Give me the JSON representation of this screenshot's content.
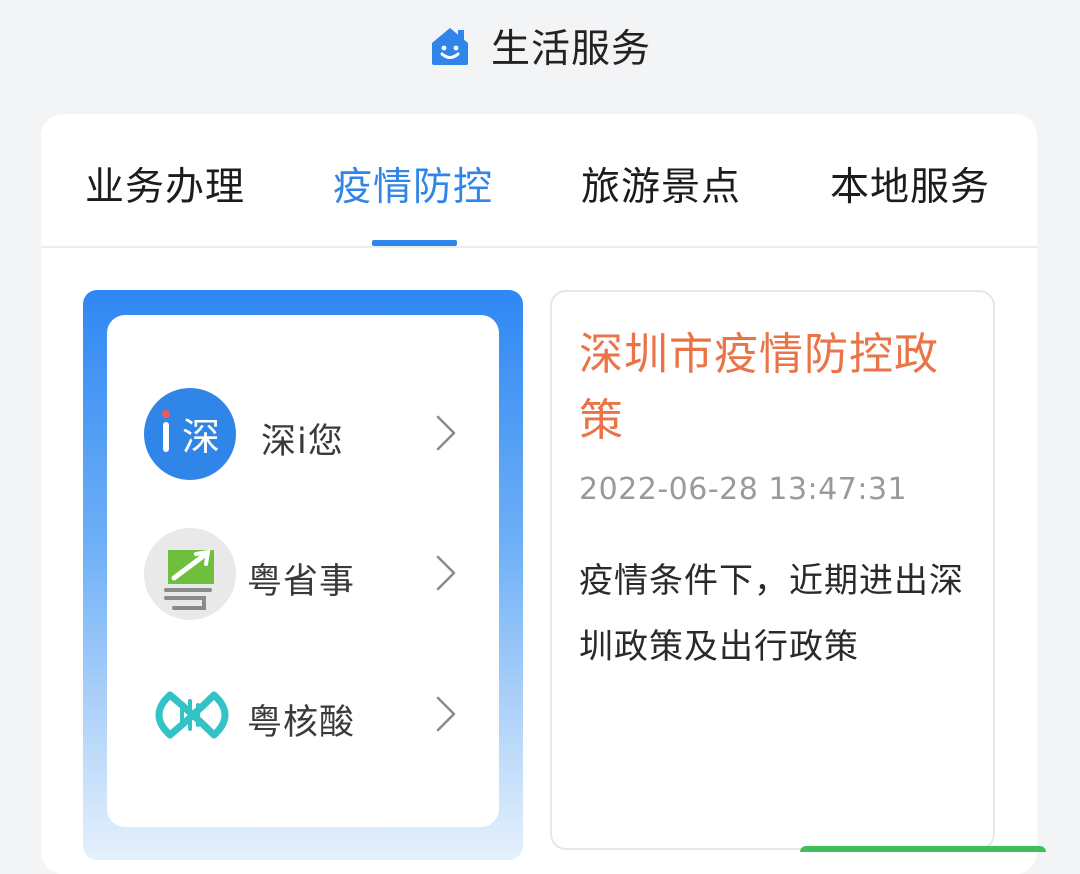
{
  "header": {
    "title": "生活服务",
    "icon": "home-smile-icon",
    "icon_color": "#2f86e8"
  },
  "tabs": [
    {
      "label": "业务办理",
      "active": false
    },
    {
      "label": "疫情防控",
      "active": true
    },
    {
      "label": "旅游景点",
      "active": false
    },
    {
      "label": "本地服务",
      "active": false
    }
  ],
  "apps": [
    {
      "label": "深i您",
      "icon": "shen-i-nin-logo-icon",
      "logo_text": "i深"
    },
    {
      "label": "粤省事",
      "icon": "yue-sheng-shi-logo-icon"
    },
    {
      "label": "粤核酸",
      "icon": "yue-he-suan-logo-icon"
    }
  ],
  "news": {
    "title": "深圳市疫情防控政策",
    "time": "2022-06-28 13:47:31",
    "description": "疫情条件下，近期进出深圳政策及出行政策"
  },
  "colors": {
    "accent": "#2f86e8",
    "news_title": "#ea7447",
    "panel_gradient_top": "#2f87f3",
    "panel_gradient_bottom": "#e5f1fd"
  }
}
